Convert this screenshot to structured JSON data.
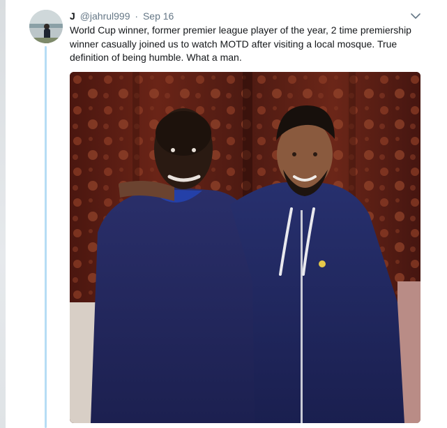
{
  "tweet": {
    "display_name": "J",
    "handle": "@jahrul999",
    "separator": "·",
    "date": "Sep 16",
    "text": "World Cup winner, former premier league player of the year, 2 time premiership winner casually joined us to watch MOTD after visiting a local mosque. True definition of being humble. What a man.",
    "caret_icon": "chevron-down-icon",
    "media_icon": "photo"
  },
  "colors": {
    "text_primary": "#14171a",
    "text_secondary": "#657786",
    "thread_line": "#b6ddf5",
    "curtain": "#5a1e14"
  }
}
